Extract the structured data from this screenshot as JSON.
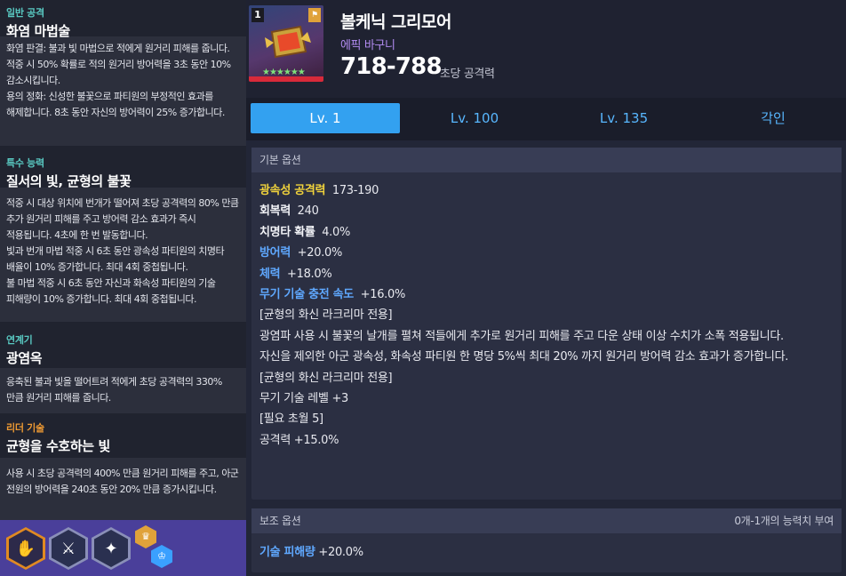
{
  "colors": {
    "accent": "#33a1f0",
    "epic": "#b38cf2",
    "yellow": "#f0d23c",
    "blue": "#5fa8ff",
    "purple": "#b48cff",
    "teal": "#59c9c2",
    "orange": "#ee9a33"
  },
  "skills": [
    {
      "type": "일반 공격",
      "title": "화염 마법술",
      "desc": "화염 판결: 불과 빛 마법으로 적에게 원거리 피해를 줍니다. 적중 시 50% 확률로 적의 원거리 방어력을 3초 동안 10% 감소시킵니다.\n용의 정화: 신성한 불꽃으로 파티원의 부정적인 효과를 해제합니다. 8초 동안 자신의 방어력이 25% 증가합니다."
    },
    {
      "type": "특수 능력",
      "title": "질서의 빛, 균형의 불꽃",
      "desc": "적중 시 대상 위치에 번개가 떨어져 초당 공격력의 80% 만큼 추가 원거리 피해를 주고 방어력 감소 효과가 즉시 적용됩니다. 4초에 한 번 발동합니다.\n빛과 번개 마법 적중 시 6초 동안 광속성 파티원의 치명타 배율이 10% 증가합니다. 최대 4회 중첩됩니다.\n불 마법 적중 시 6초 동안 자신과 화속성 파티원의 기술 피해량이 10% 증가합니다. 최대 4회 중첩됩니다."
    },
    {
      "type": "연계기",
      "title": "광염옥",
      "desc": "응축된 불과 빛을 떨어트려 적에게 초당 공격력의 330% 만큼 원거리 피해를 줍니다."
    },
    {
      "type": "리더 기술",
      "title": "균형을 수호하는 빛",
      "desc": "사용 시 초당 공격력의 400% 만큼 원거리 피해를 주고, 아군 전원의 방어력을 240초 동안 20% 만큼 증가시킵니다."
    }
  ],
  "skill_icons": [
    "fire-hand-icon",
    "sword-icon",
    "sparkle-icon",
    "chain-badge-icon"
  ],
  "weapon": {
    "rank": "1",
    "stars": "★★★★★★",
    "name": "볼케닉 그리모어",
    "grade": "에픽 바구니",
    "attack": "718-788",
    "attack_label": "초당 공격력"
  },
  "tabs": [
    "Lv. 1",
    "Lv. 100",
    "Lv. 135",
    "각인"
  ],
  "basic_options": {
    "header": "기본 옵션",
    "lines": [
      {
        "key": "광속성 공격력",
        "value": "173-190",
        "color": "yellow"
      },
      {
        "key": "회복력",
        "value": "240",
        "color": "white"
      },
      {
        "key": "치명타 확률",
        "value": "4.0%",
        "color": "white"
      },
      {
        "key": "방어력",
        "value": "+20.0%",
        "color": "blue"
      },
      {
        "key": "체력",
        "value": "+18.0%",
        "color": "blue"
      },
      {
        "key": "무기 기술 충전 속도",
        "value": "+16.0%",
        "color": "blue"
      },
      {
        "key": "",
        "value": "[균형의 화신 라크리마 전용]",
        "color": ""
      },
      {
        "key": "",
        "value": "광염파 사용 시 불꽃의 날개를 펼쳐 적들에게 추가로 원거리 피해를 주고 다운 상태 이상 수치가 소폭 적용됩니다.",
        "color": ""
      },
      {
        "key": "",
        "value": "자신을 제외한 아군 광속성, 화속성 파티원 한 명당 5%씩 최대 20% 까지 원거리 방어력 감소 효과가 증가합니다.",
        "color": ""
      },
      {
        "key": "",
        "value": "[균형의 화신 라크리마 전용]",
        "color": ""
      },
      {
        "key": "",
        "value": "무기 기술 레벨 +3",
        "color": ""
      },
      {
        "key": "",
        "value": "[필요 초월 5]",
        "color": ""
      },
      {
        "key": "",
        "value": "공격력 +15.0%",
        "color": ""
      }
    ]
  },
  "sub_options": {
    "header": "보조 옵션",
    "count": "0개-1개의 능력치 부여",
    "line": {
      "key": "기술 피해량",
      "value": "+20.0%",
      "color": "blue"
    }
  }
}
